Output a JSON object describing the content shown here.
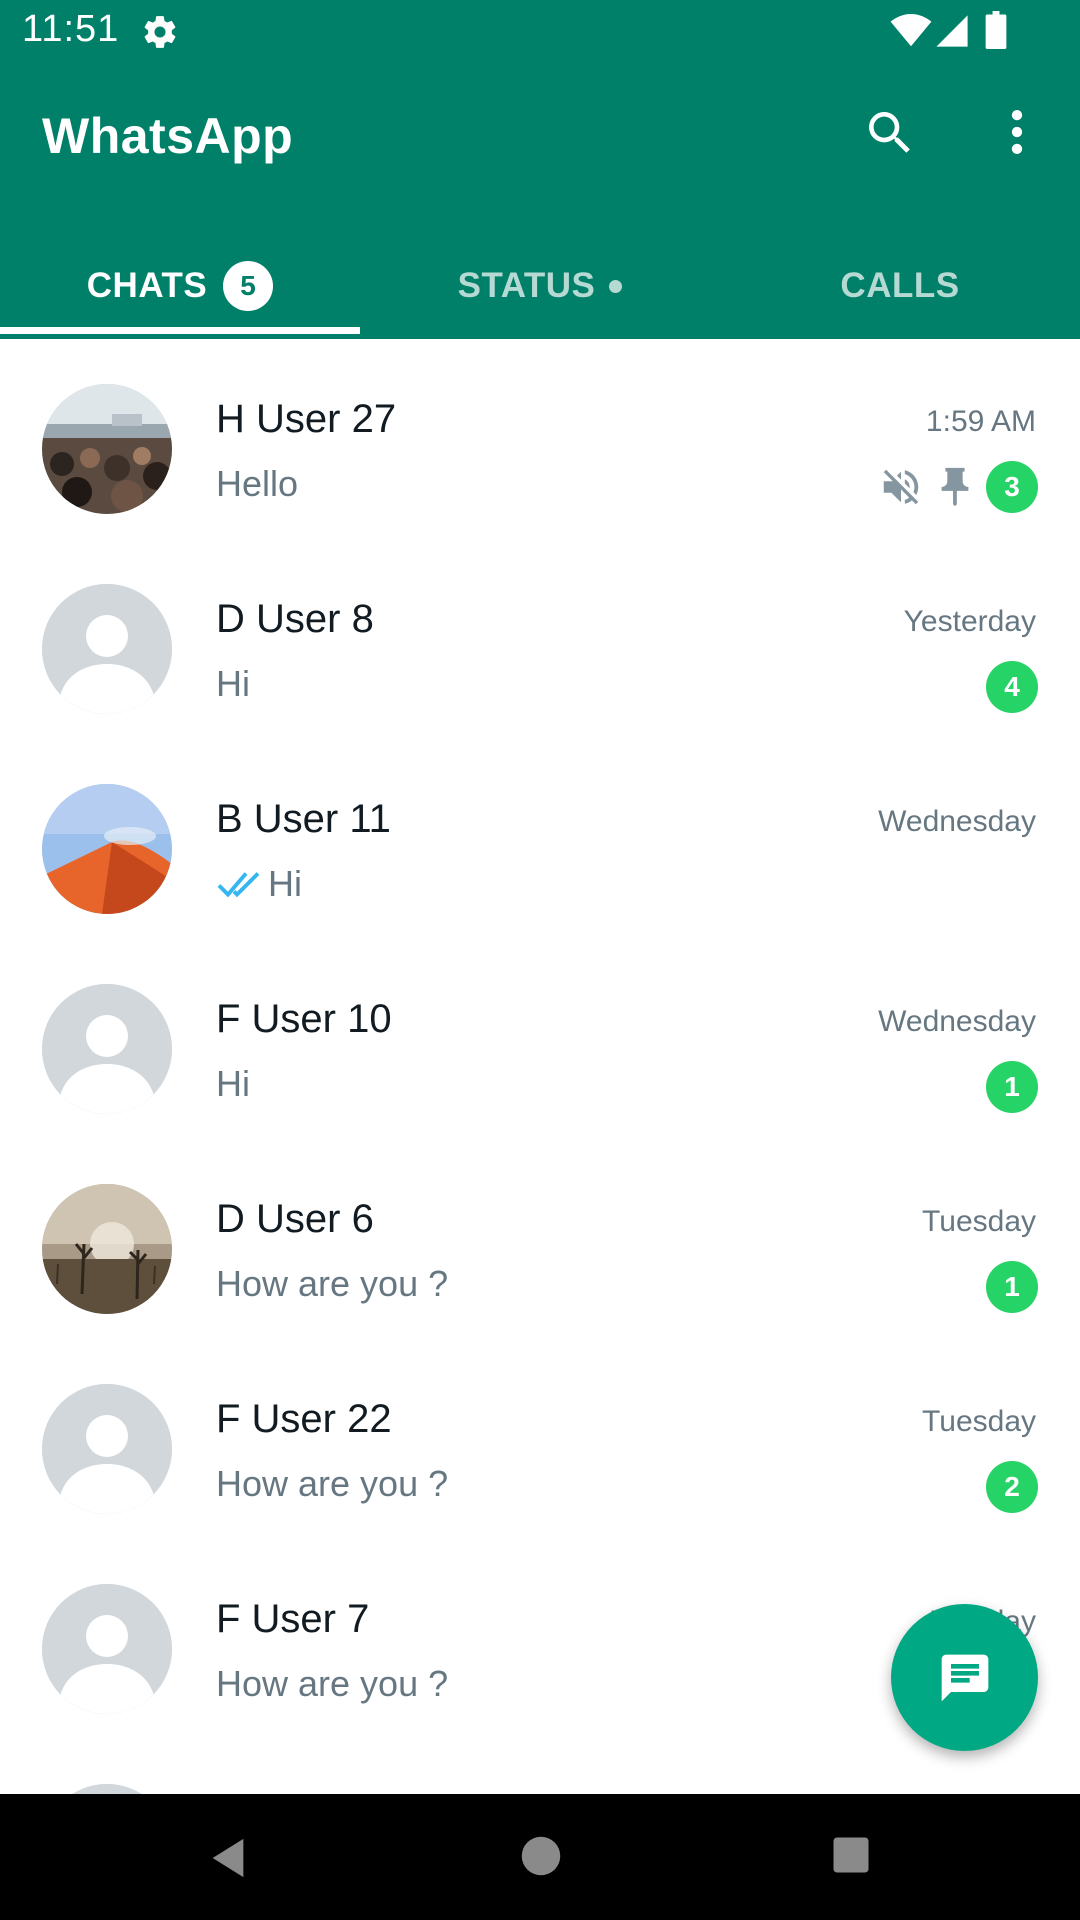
{
  "status_bar": {
    "time": "11:51",
    "icons": [
      "gear-icon",
      "wifi-icon",
      "signal-icon",
      "battery-icon"
    ]
  },
  "app_bar": {
    "title": "WhatsApp",
    "search_icon": "search-icon",
    "more_icon": "more-vert-icon",
    "background": "#008069"
  },
  "tabs": [
    {
      "label": "CHATS",
      "badge": "5",
      "selected": true
    },
    {
      "label": "STATUS",
      "indicator": "dot"
    },
    {
      "label": "CALLS"
    }
  ],
  "chats": [
    {
      "name": "H User 27",
      "time": "1:59 AM",
      "message": "Hello",
      "unread": "3",
      "muted": true,
      "pinned": true,
      "avatar": "photo-crowd"
    },
    {
      "name": "D User 8",
      "time": "Yesterday",
      "message": "Hi",
      "unread": "4",
      "avatar": "default"
    },
    {
      "name": "B User 11",
      "time": "Wednesday",
      "message": "Hi",
      "read_ticks": true,
      "avatar": "photo-dune"
    },
    {
      "name": "F User 10",
      "time": "Wednesday",
      "message": "Hi",
      "unread": "1",
      "avatar": "default"
    },
    {
      "name": "D User 6",
      "time": "Tuesday",
      "message": "How are you ?",
      "unread": "1",
      "avatar": "photo-trees"
    },
    {
      "name": "F User 22",
      "time": "Tuesday",
      "message": "How are you ?",
      "unread": "2",
      "avatar": "default"
    },
    {
      "name": "F User 7",
      "time": "Monday",
      "message": "How are you ?",
      "avatar": "default"
    }
  ],
  "fab": {
    "icon": "new-chat-icon",
    "color": "#00a884"
  },
  "colors": {
    "unread_badge": "#25d366",
    "read_ticks": "#34b7f1"
  },
  "nav_bar": {
    "icons": [
      "back-icon",
      "home-icon",
      "recents-icon"
    ]
  }
}
